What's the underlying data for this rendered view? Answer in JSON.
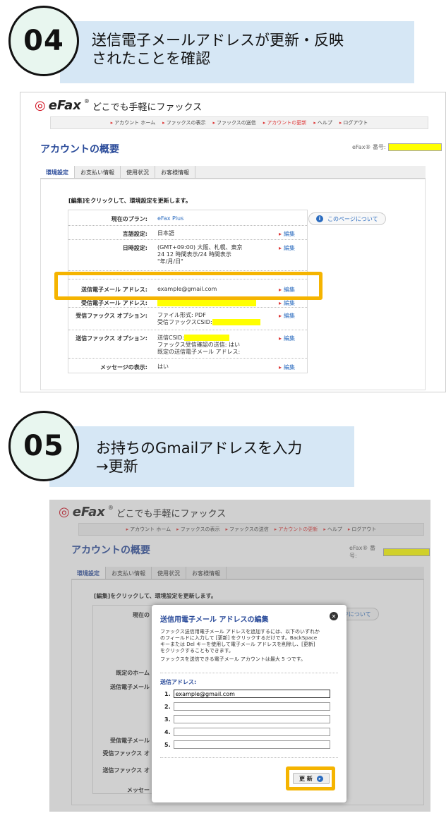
{
  "colors": {
    "highlight": "#f5b400",
    "accent": "#2a4b9a",
    "link": "#2a6bbf",
    "redaction": "#ffff00"
  },
  "step4": {
    "number": "04",
    "line1": "送信電子メールアドレスが更新・反映",
    "line2": "されたことを確認"
  },
  "step5": {
    "number": "05",
    "line1": "お持ちのGmailアドレスを入力",
    "line2": "→更新"
  },
  "app": {
    "logo": "eFax",
    "registered": "®",
    "tagline": "どこでも手軽にファックス",
    "nav": [
      "アカウント ホーム",
      "ファックスの表示",
      "ファックスの送信",
      "アカウントの更新",
      "ヘルプ",
      "ログアウト"
    ],
    "page_title": "アカウントの概要",
    "fax_number_label": "eFax® 番号:",
    "tabs": [
      "環境設定",
      "お支払い情報",
      "使用状況",
      "お客様情報"
    ],
    "instruction": "[編集]をクリックして、環境設定を更新します。",
    "about_page": "このページについて",
    "edit": "編集"
  },
  "settings": {
    "plan_label": "現在のプラン:",
    "plan_value": "eFax Plus",
    "language_label": "言語設定:",
    "language_value": "日本語",
    "datetime_label": "日時設定:",
    "datetime_value1": "(GMT+09:00) 大阪、札幌、東京",
    "datetime_value2": "24 12 時間表示/24 時間表示",
    "datetime_value3": "\"年/月/日\"",
    "send_email_label": "送信電子メール アドレス:",
    "send_email_value": "example@gmail.com",
    "recv_email_label": "受信電子メール アドレス:",
    "recv_fax_label": "受信ファックス オプション:",
    "recv_fax_value1": "ファイル形式: PDF",
    "recv_fax_value2": "受信ファックスCSID:",
    "send_fax_label": "送信ファックス オプション:",
    "send_fax_value1": "送信CSID:",
    "send_fax_value2": "ファックス受信確認の送信: はい",
    "send_fax_value3": "既定の送信電子メール アドレス:",
    "message_label": "メッセージの表示:",
    "message_value": "はい"
  },
  "shot2_labels": {
    "current": "現在の",
    "default_home": "既定のホーム",
    "send_email": "送信電子メール",
    "recv_email": "受信電子メール",
    "recv_fax": "受信ファックス オ",
    "send_fax": "送信ファックス オ",
    "message": "メッセー",
    "about_partial": "ページについて"
  },
  "modal": {
    "title": "送信用電子メール アドレスの編集",
    "desc1": "ファックス送信用電子メール アドレスを追加するには、以下のいずれか",
    "desc2": "のフィールドに入力して [更新] をクリックするだけです。BackSpace",
    "desc3": "キーまたは Del キーを使用して電子メール アドレスを削除し、[更新]",
    "desc4": "をクリックすることもできます。",
    "desc5": "ファックスを送信できる電子メール アカウントは最大 5 つです。",
    "addresses_label": "送信アドレス:",
    "addresses": [
      {
        "num": "1.",
        "value": "example@gmail.com"
      },
      {
        "num": "2.",
        "value": ""
      },
      {
        "num": "3.",
        "value": ""
      },
      {
        "num": "4.",
        "value": ""
      },
      {
        "num": "5.",
        "value": ""
      }
    ],
    "update_label": "更 新"
  }
}
